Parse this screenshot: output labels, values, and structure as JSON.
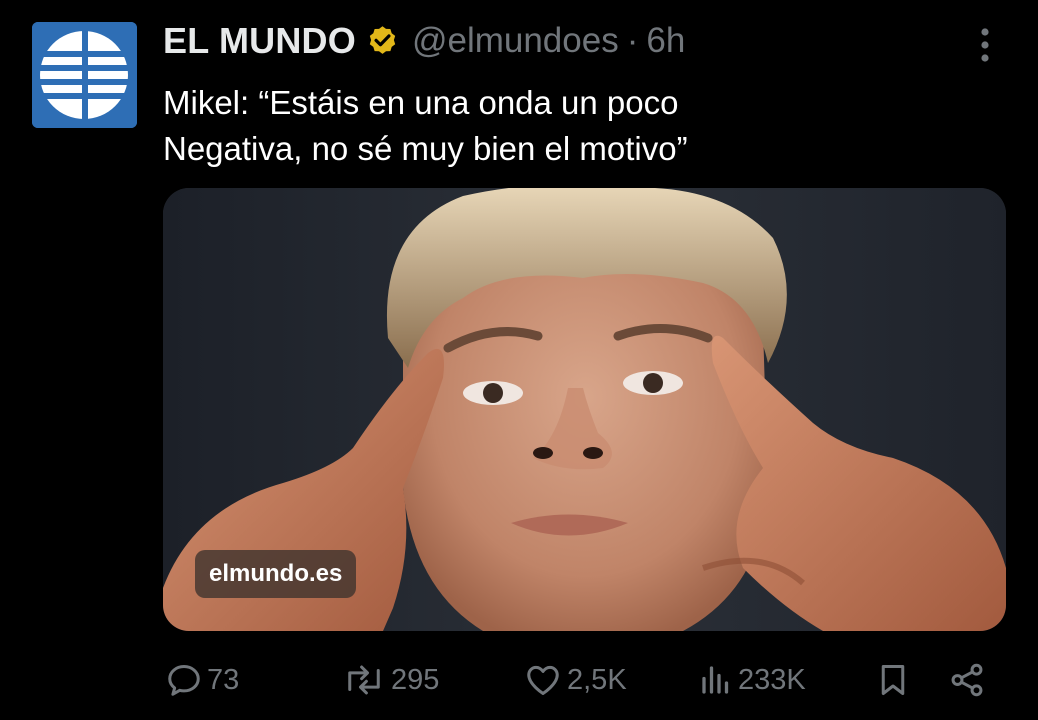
{
  "tweet": {
    "author_name": "EL MUNDO",
    "handle": "@elmundoes",
    "separator": "·",
    "time": "6h",
    "text_line1": "Mikel: “Estáis en una onda un poco",
    "text_line2": "Negativa, no sé muy bien el motivo”",
    "media_watermark": "elmundo.es"
  },
  "actions": {
    "replies": "73",
    "reposts": "295",
    "likes": "2,5K",
    "views": "233K"
  },
  "icons": [
    "el-mundo-logo-icon",
    "verified-badge-icon",
    "more-options-icon",
    "reply-icon",
    "repost-icon",
    "like-icon",
    "views-icon",
    "bookmark-icon",
    "share-icon"
  ],
  "colors": {
    "background": "#000000",
    "text_primary": "#e7e9ea",
    "text_secondary": "#71767b",
    "verified_gold": "#e2b719",
    "logo_blue": "#2e6eb5"
  }
}
